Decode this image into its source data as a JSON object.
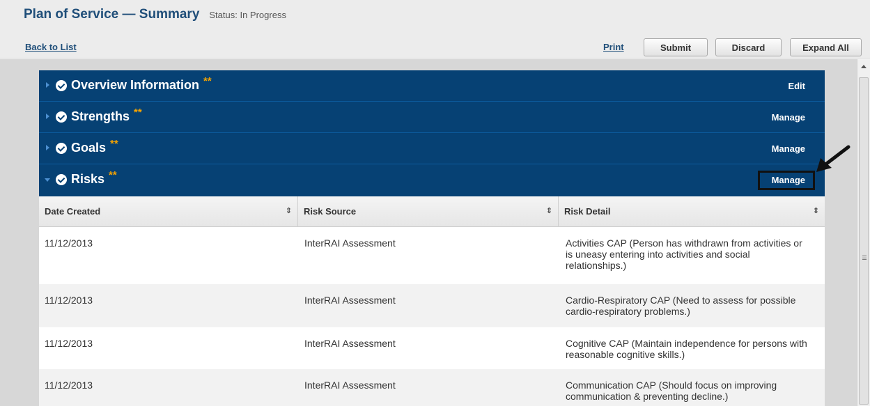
{
  "header": {
    "title": "Plan of Service — Summary",
    "status": "Status: In Progress"
  },
  "toolbar": {
    "back_label": "Back to List",
    "print_label": "Print",
    "submit_label": "Submit",
    "discard_label": "Discard",
    "expand_all_label": "Expand All"
  },
  "sections": [
    {
      "title": "Overview Information",
      "stars": "**",
      "action": "Edit",
      "expanded": false
    },
    {
      "title": "Strengths",
      "stars": "**",
      "action": "Manage",
      "expanded": false
    },
    {
      "title": "Goals",
      "stars": "**",
      "action": "Manage",
      "expanded": false
    },
    {
      "title": "Risks",
      "stars": "**",
      "action": "Manage",
      "expanded": true
    }
  ],
  "risks_table": {
    "columns": [
      "Date Created",
      "Risk Source",
      "Risk Detail"
    ],
    "rows": [
      {
        "date": "11/12/2013",
        "source": "InterRAI Assessment",
        "detail": "Activities CAP (Person has withdrawn from activities or is uneasy entering into activities and social relationships.)"
      },
      {
        "date": "11/12/2013",
        "source": "InterRAI Assessment",
        "detail": "Cardio-Respiratory CAP (Need to assess for possible cardio-respiratory problems.)"
      },
      {
        "date": "11/12/2013",
        "source": "InterRAI Assessment",
        "detail": "Cognitive CAP (Maintain independence for persons with reasonable cognitive skills.)"
      },
      {
        "date": "11/12/2013",
        "source": "InterRAI Assessment",
        "detail": "Communication CAP (Should focus on improving communication & preventing decline.)"
      }
    ]
  },
  "colors": {
    "section_bg": "#064174",
    "star": "#f6a400",
    "link": "#1f4e79"
  }
}
